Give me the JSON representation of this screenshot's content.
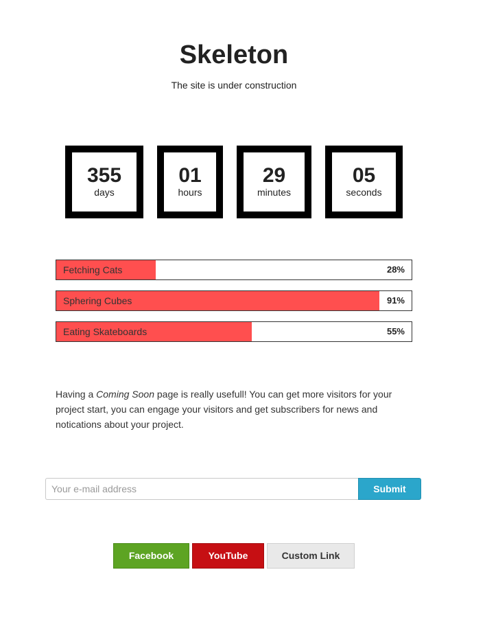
{
  "header": {
    "title": "Skeleton",
    "subtitle": "The site is under construction"
  },
  "countdown": [
    {
      "value": "355",
      "unit": "days"
    },
    {
      "value": "01",
      "unit": "hours"
    },
    {
      "value": "29",
      "unit": "minutes"
    },
    {
      "value": "05",
      "unit": "seconds"
    }
  ],
  "progress": [
    {
      "label": "Fetching Cats",
      "percent_text": "28%",
      "value": 0.28
    },
    {
      "label": "Sphering Cubes",
      "percent_text": "91%",
      "value": 0.91
    },
    {
      "label": "Eating Skateboards",
      "percent_text": "55%",
      "value": 0.55
    }
  ],
  "intro": {
    "before": "Having a ",
    "emphasis": "Coming Soon",
    "after": " page is really usefull! You can get more visitors for your project start, you can engage your visitors and get subscribers for news and notications about your project."
  },
  "subscribe": {
    "email_placeholder": "Your e-mail address",
    "email_value": "",
    "submit_label": "Submit"
  },
  "social": {
    "facebook_label": "Facebook",
    "youtube_label": "YouTube",
    "custom_label": "Custom Link"
  },
  "colors": {
    "progress_fill": "#ff4f4f",
    "submit": "#2ba6cb",
    "facebook": "#5da423",
    "youtube": "#c60f13",
    "custom": "#e9e9e9"
  }
}
